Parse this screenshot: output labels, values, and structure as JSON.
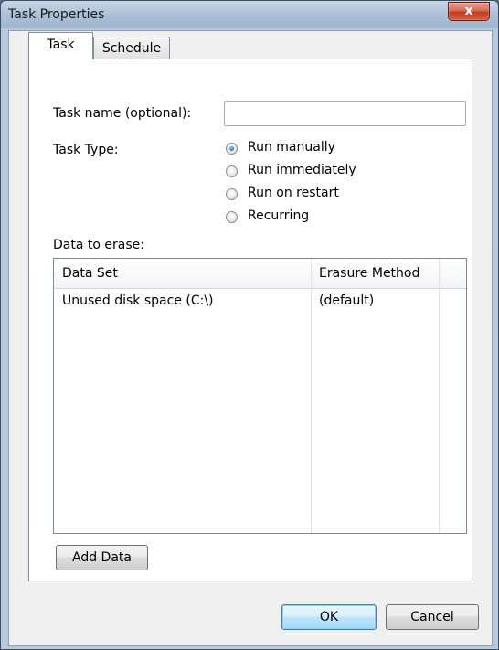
{
  "window": {
    "title": "Task Properties",
    "close_label": "x"
  },
  "tabs": [
    {
      "label": "Task",
      "selected": true
    },
    {
      "label": "Schedule",
      "selected": false
    }
  ],
  "task": {
    "name_label": "Task name (optional):",
    "name_value": "",
    "type_label": "Task Type:",
    "task_types": [
      {
        "label": "Run manually",
        "checked": true
      },
      {
        "label": "Run immediately",
        "checked": false
      },
      {
        "label": "Run on restart",
        "checked": false
      },
      {
        "label": "Recurring",
        "checked": false
      }
    ],
    "data_label": "Data to erase:",
    "columns": [
      "Data Set",
      "Erasure Method"
    ],
    "rows": [
      {
        "data_set": "Unused disk space (C:\\)",
        "method": "(default)"
      }
    ],
    "add_data_label": "Add Data"
  },
  "footer": {
    "ok_label": "OK",
    "cancel_label": "Cancel"
  },
  "colors": {
    "accent": "#1e74c7",
    "close_button": "#c23b22"
  }
}
